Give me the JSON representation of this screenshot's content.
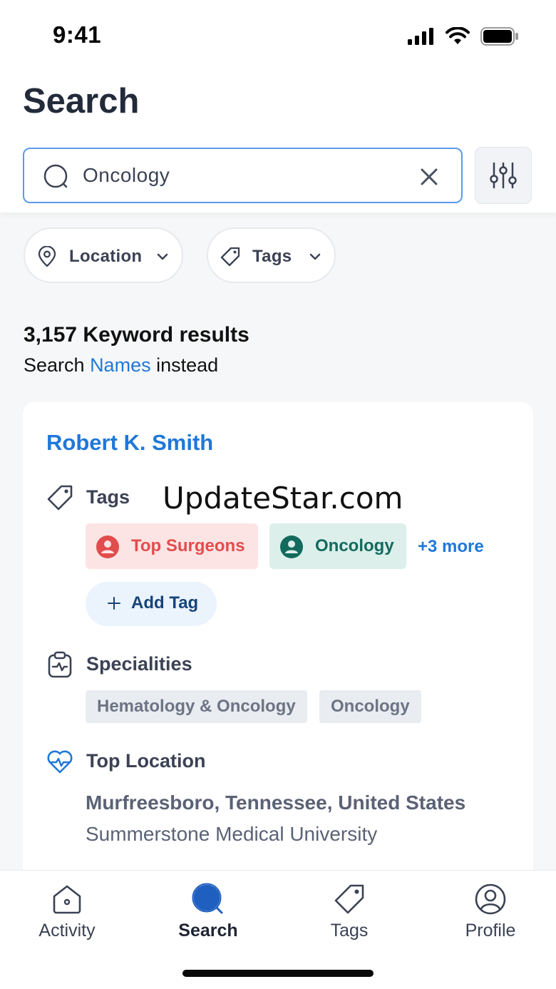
{
  "status_bar": {
    "time": "9:41"
  },
  "page": {
    "title": "Search"
  },
  "search": {
    "value": "Oncology"
  },
  "filters": [
    {
      "label": "Location"
    },
    {
      "label": "Tags"
    }
  ],
  "results": {
    "count_text": "3,157 Keyword results",
    "alt_prefix": "Search ",
    "alt_link": "Names",
    "alt_suffix": " instead"
  },
  "card": {
    "name": "Robert K. Smith",
    "tags_label": "Tags",
    "watermark": "UpdateStar.com",
    "tags": [
      {
        "label": "Top Surgeons",
        "color": "#e24c4c",
        "bg": "#fde4e4"
      },
      {
        "label": "Oncology",
        "color": "#136b5d",
        "bg": "#dcefeb"
      }
    ],
    "more_tags": "+3 more",
    "add_tag": "Add Tag",
    "specialities_label": "Specialities",
    "specialities": [
      "Hematology & Oncology",
      "Oncology"
    ],
    "top_location_label": "Top Location",
    "location": "Murfreesboro, Tennessee, United States",
    "institution": "Summerstone Medical University"
  },
  "tab_bar": {
    "tabs": [
      {
        "label": "Activity",
        "icon": "home-icon",
        "active": false
      },
      {
        "label": "Search",
        "icon": "search-icon",
        "active": true
      },
      {
        "label": "Tags",
        "icon": "tag-icon",
        "active": false
      },
      {
        "label": "Profile",
        "icon": "profile-icon",
        "active": false
      }
    ]
  },
  "colors": {
    "accent": "#1f78d9",
    "search_border": "#5b9bea",
    "active_tab": "#1f5fbf"
  }
}
